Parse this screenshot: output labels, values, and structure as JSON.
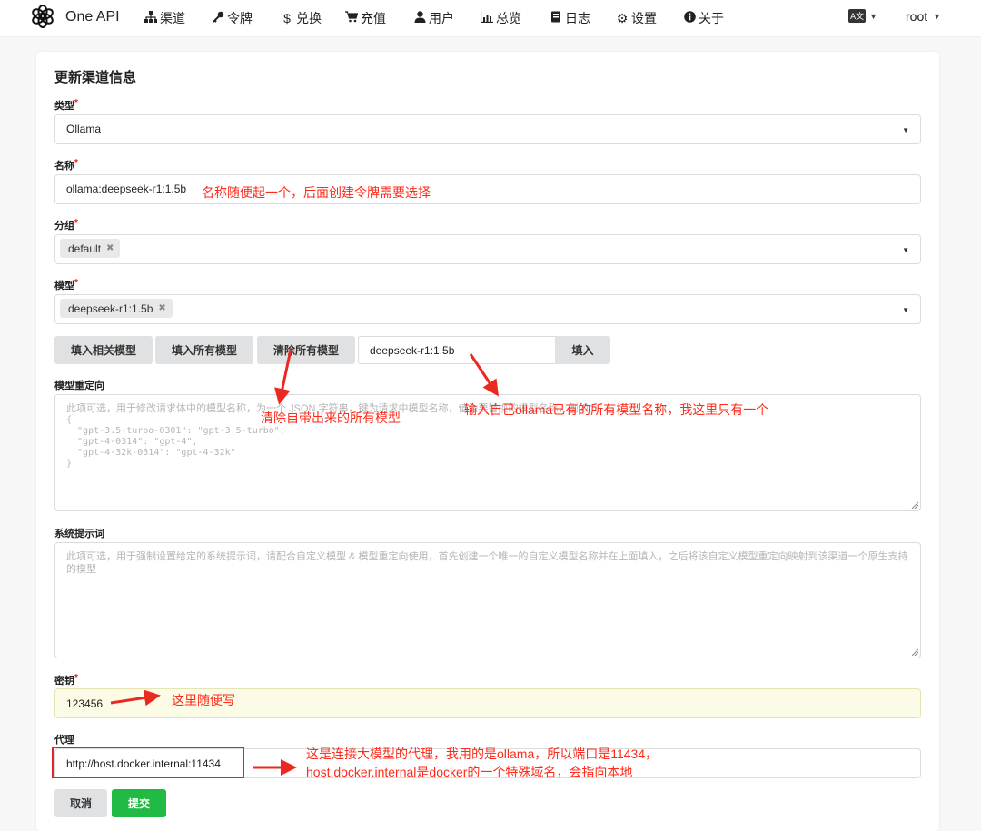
{
  "nav": {
    "brand": "One API",
    "items": [
      {
        "icon": "sitemap-icon",
        "label": "渠道"
      },
      {
        "icon": "key-icon",
        "label": "令牌"
      },
      {
        "icon": "dollar-icon",
        "label": "兑换"
      },
      {
        "icon": "cart-icon",
        "label": "充值"
      },
      {
        "icon": "user-icon",
        "label": "用户"
      },
      {
        "icon": "chart-icon",
        "label": "总览"
      },
      {
        "icon": "book-icon",
        "label": "日志"
      },
      {
        "icon": "gear-icon",
        "label": "设置"
      },
      {
        "icon": "info-icon",
        "label": "关于"
      }
    ],
    "user": "root"
  },
  "form": {
    "title": "更新渠道信息",
    "type_label": "类型",
    "type_value": "Ollama",
    "name_label": "名称",
    "name_value": "ollama:deepseek-r1:1.5b",
    "group_label": "分组",
    "group_chip": "default",
    "model_label": "模型",
    "model_chip": "deepseek-r1:1.5b",
    "buttons": {
      "fill_related": "填入相关模型",
      "fill_all": "填入所有模型",
      "clear_all": "清除所有模型",
      "custom_model_value": "deepseek-r1:1.5b",
      "fill": "填入"
    },
    "redirect_label": "模型重定向",
    "redirect_placeholder_line1": "此项可选，用于修改请求体中的模型名称，为一个 JSON 字符串，键为请求中模型名称，值为要替换的模型名称，例如：",
    "redirect_placeholder_json": "{\n  \"gpt-3.5-turbo-0301\": \"gpt-3.5-turbo\",\n  \"gpt-4-0314\": \"gpt-4\",\n  \"gpt-4-32k-0314\": \"gpt-4-32k\"\n}",
    "system_prompt_label": "系统提示词",
    "system_prompt_placeholder": "此项可选，用于强制设置给定的系统提示词，请配合自定义模型 & 模型重定向使用，首先创建一个唯一的自定义模型名称并在上面填入，之后将该自定义模型重定向映射到该渠道一个原生支持的模型",
    "key_label": "密钥",
    "key_value": "123456",
    "proxy_label": "代理",
    "proxy_value": "http://host.docker.internal:11434",
    "cancel": "取消",
    "submit": "提交"
  },
  "annotations": {
    "name_note": "名称随便起一个，后面创建令牌需要选择",
    "clear_note": "清除自带出来的所有模型",
    "fill_note": "输入自己ollama已有的所有模型名称，我这里只有一个",
    "key_note": "这里随便写",
    "proxy_note_line1": "这是连接大模型的代理，我用的是ollama，所以端口是11434，",
    "proxy_note_line2": "host.docker.internal是docker的一个特殊域名，会指向本地"
  },
  "colors": {
    "accent_green": "#21ba45",
    "annotation_red": "#ff2a1a",
    "key_field_bg": "#fcfbe5",
    "required_star": "#db2828"
  }
}
